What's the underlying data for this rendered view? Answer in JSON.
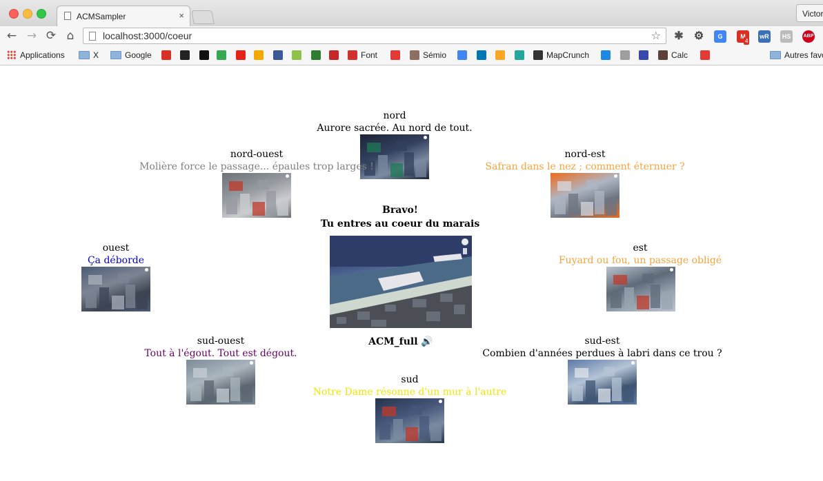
{
  "browser": {
    "tab_title": "ACMSampler",
    "tab_close": "×",
    "profile_name": "Victor",
    "url": "localhost:3000/coeur",
    "nav": {
      "back": "←",
      "forward": "→",
      "reload": "⟳",
      "home": "⌂"
    },
    "star": "☆",
    "extensions": [
      {
        "name": "puzzle-extension-icon",
        "label": "✱",
        "color": "#555555"
      },
      {
        "name": "gear-icon",
        "label": "⚙",
        "color": "#444444"
      },
      {
        "name": "translate-icon",
        "label": "G",
        "color": "#4285f4"
      },
      {
        "name": "gmail-icon",
        "label": "M",
        "color": "#d93025",
        "badge": "4"
      },
      {
        "name": "wordreference-icon",
        "label": "wR",
        "color": "#3b6fb6"
      },
      {
        "name": "hs-icon",
        "label": "HS",
        "color": "#bbbbbb"
      },
      {
        "name": "adblock-icon",
        "label": "ABP",
        "color": "#d0021b"
      }
    ]
  },
  "bookmarks": [
    {
      "name": "bookmark-applications",
      "label": "Applications",
      "kind": "apps"
    },
    {
      "name": "bookmark-x",
      "label": "X",
      "kind": "folder"
    },
    {
      "name": "bookmark-google",
      "label": "Google",
      "kind": "folder"
    },
    {
      "name": "bookmark-gmail",
      "label": "",
      "kind": "icon",
      "color": "#d93025"
    },
    {
      "name": "bookmark-wtf",
      "label": "",
      "kind": "icon",
      "color": "#222222"
    },
    {
      "name": "bookmark-circle",
      "label": "",
      "kind": "icon",
      "color": "#111111"
    },
    {
      "name": "bookmark-maps",
      "label": "",
      "kind": "icon",
      "color": "#34a853"
    },
    {
      "name": "bookmark-youtube",
      "label": "",
      "kind": "icon",
      "color": "#e62117"
    },
    {
      "name": "bookmark-wr",
      "label": "",
      "kind": "icon",
      "color": "#f2a900"
    },
    {
      "name": "bookmark-facebook",
      "label": "",
      "kind": "icon",
      "color": "#3b5998"
    },
    {
      "name": "bookmark-blabla",
      "label": "",
      "kind": "icon",
      "color": "#8fc24a"
    },
    {
      "name": "bookmark-diag",
      "label": "",
      "kind": "icon",
      "color": "#2e7d32"
    },
    {
      "name": "bookmark-flag",
      "label": "",
      "kind": "icon",
      "color": "#c62828"
    },
    {
      "name": "bookmark-font",
      "label": "Font",
      "kind": "icon",
      "color": "#d32f2f"
    },
    {
      "name": "bookmark-e",
      "label": "",
      "kind": "icon",
      "color": "#e53935"
    },
    {
      "name": "bookmark-semio",
      "label": "Sémio",
      "kind": "icon",
      "color": "#8d6e63"
    },
    {
      "name": "bookmark-translate",
      "label": "",
      "kind": "icon",
      "color": "#4285f4"
    },
    {
      "name": "bookmark-linkedin",
      "label": "",
      "kind": "icon",
      "color": "#0077b5"
    },
    {
      "name": "bookmark-yellow",
      "label": "",
      "kind": "icon",
      "color": "#f9a825"
    },
    {
      "name": "bookmark-wave",
      "label": "",
      "kind": "icon",
      "color": "#26a69a"
    },
    {
      "name": "bookmark-mapcrunch",
      "label": "MapCrunch",
      "kind": "icon",
      "color": "#333333"
    },
    {
      "name": "bookmark-firefox",
      "label": "",
      "kind": "icon",
      "color": "#1e88e5"
    },
    {
      "name": "bookmark-gear",
      "label": "",
      "kind": "icon",
      "color": "#9e9e9e"
    },
    {
      "name": "bookmark-c",
      "label": "",
      "kind": "icon",
      "color": "#3949ab"
    },
    {
      "name": "bookmark-calc",
      "label": "Calc",
      "kind": "icon",
      "color": "#5d4037"
    },
    {
      "name": "bookmark-red",
      "label": "",
      "kind": "icon",
      "color": "#e53935"
    },
    {
      "name": "bookmark-autres",
      "label": "Autres favo",
      "kind": "folder"
    }
  ],
  "center": {
    "line1": "Bravo!",
    "line2": "Tu entres au coeur du marais",
    "audio_label": "ACM_full",
    "speaker_icon": "🔊"
  },
  "directions": [
    {
      "key": "nord",
      "label": "nord",
      "phrase": "Aurore sacrée. Au nord de tout.",
      "color": "#000000"
    },
    {
      "key": "nord-ouest",
      "label": "nord-ouest",
      "phrase": "Molière force le passage... épaules trop larges !",
      "color": "#7f7f7f"
    },
    {
      "key": "nord-est",
      "label": "nord-est",
      "phrase": "Safran dans le nez ; comment éternuer ?",
      "color": "#f4a33c"
    },
    {
      "key": "ouest",
      "label": "ouest",
      "phrase": "Ça déborde",
      "color": "#0000cc"
    },
    {
      "key": "est",
      "label": "est",
      "phrase": "Fuyard ou fou, un passage obligé",
      "color": "#f4a33c"
    },
    {
      "key": "sud-ouest",
      "label": "sud-ouest",
      "phrase": "Tout à l'égout. Tout est dégout.",
      "color": "#660066"
    },
    {
      "key": "sud-est",
      "label": "sud-est",
      "phrase": "Combien d'années perdues à labri dans ce trou ?",
      "color": "#000000"
    },
    {
      "key": "sud",
      "label": "sud",
      "phrase": "Notre Dame résonne d'un mur à l'autre",
      "color": "#f2e600"
    }
  ]
}
